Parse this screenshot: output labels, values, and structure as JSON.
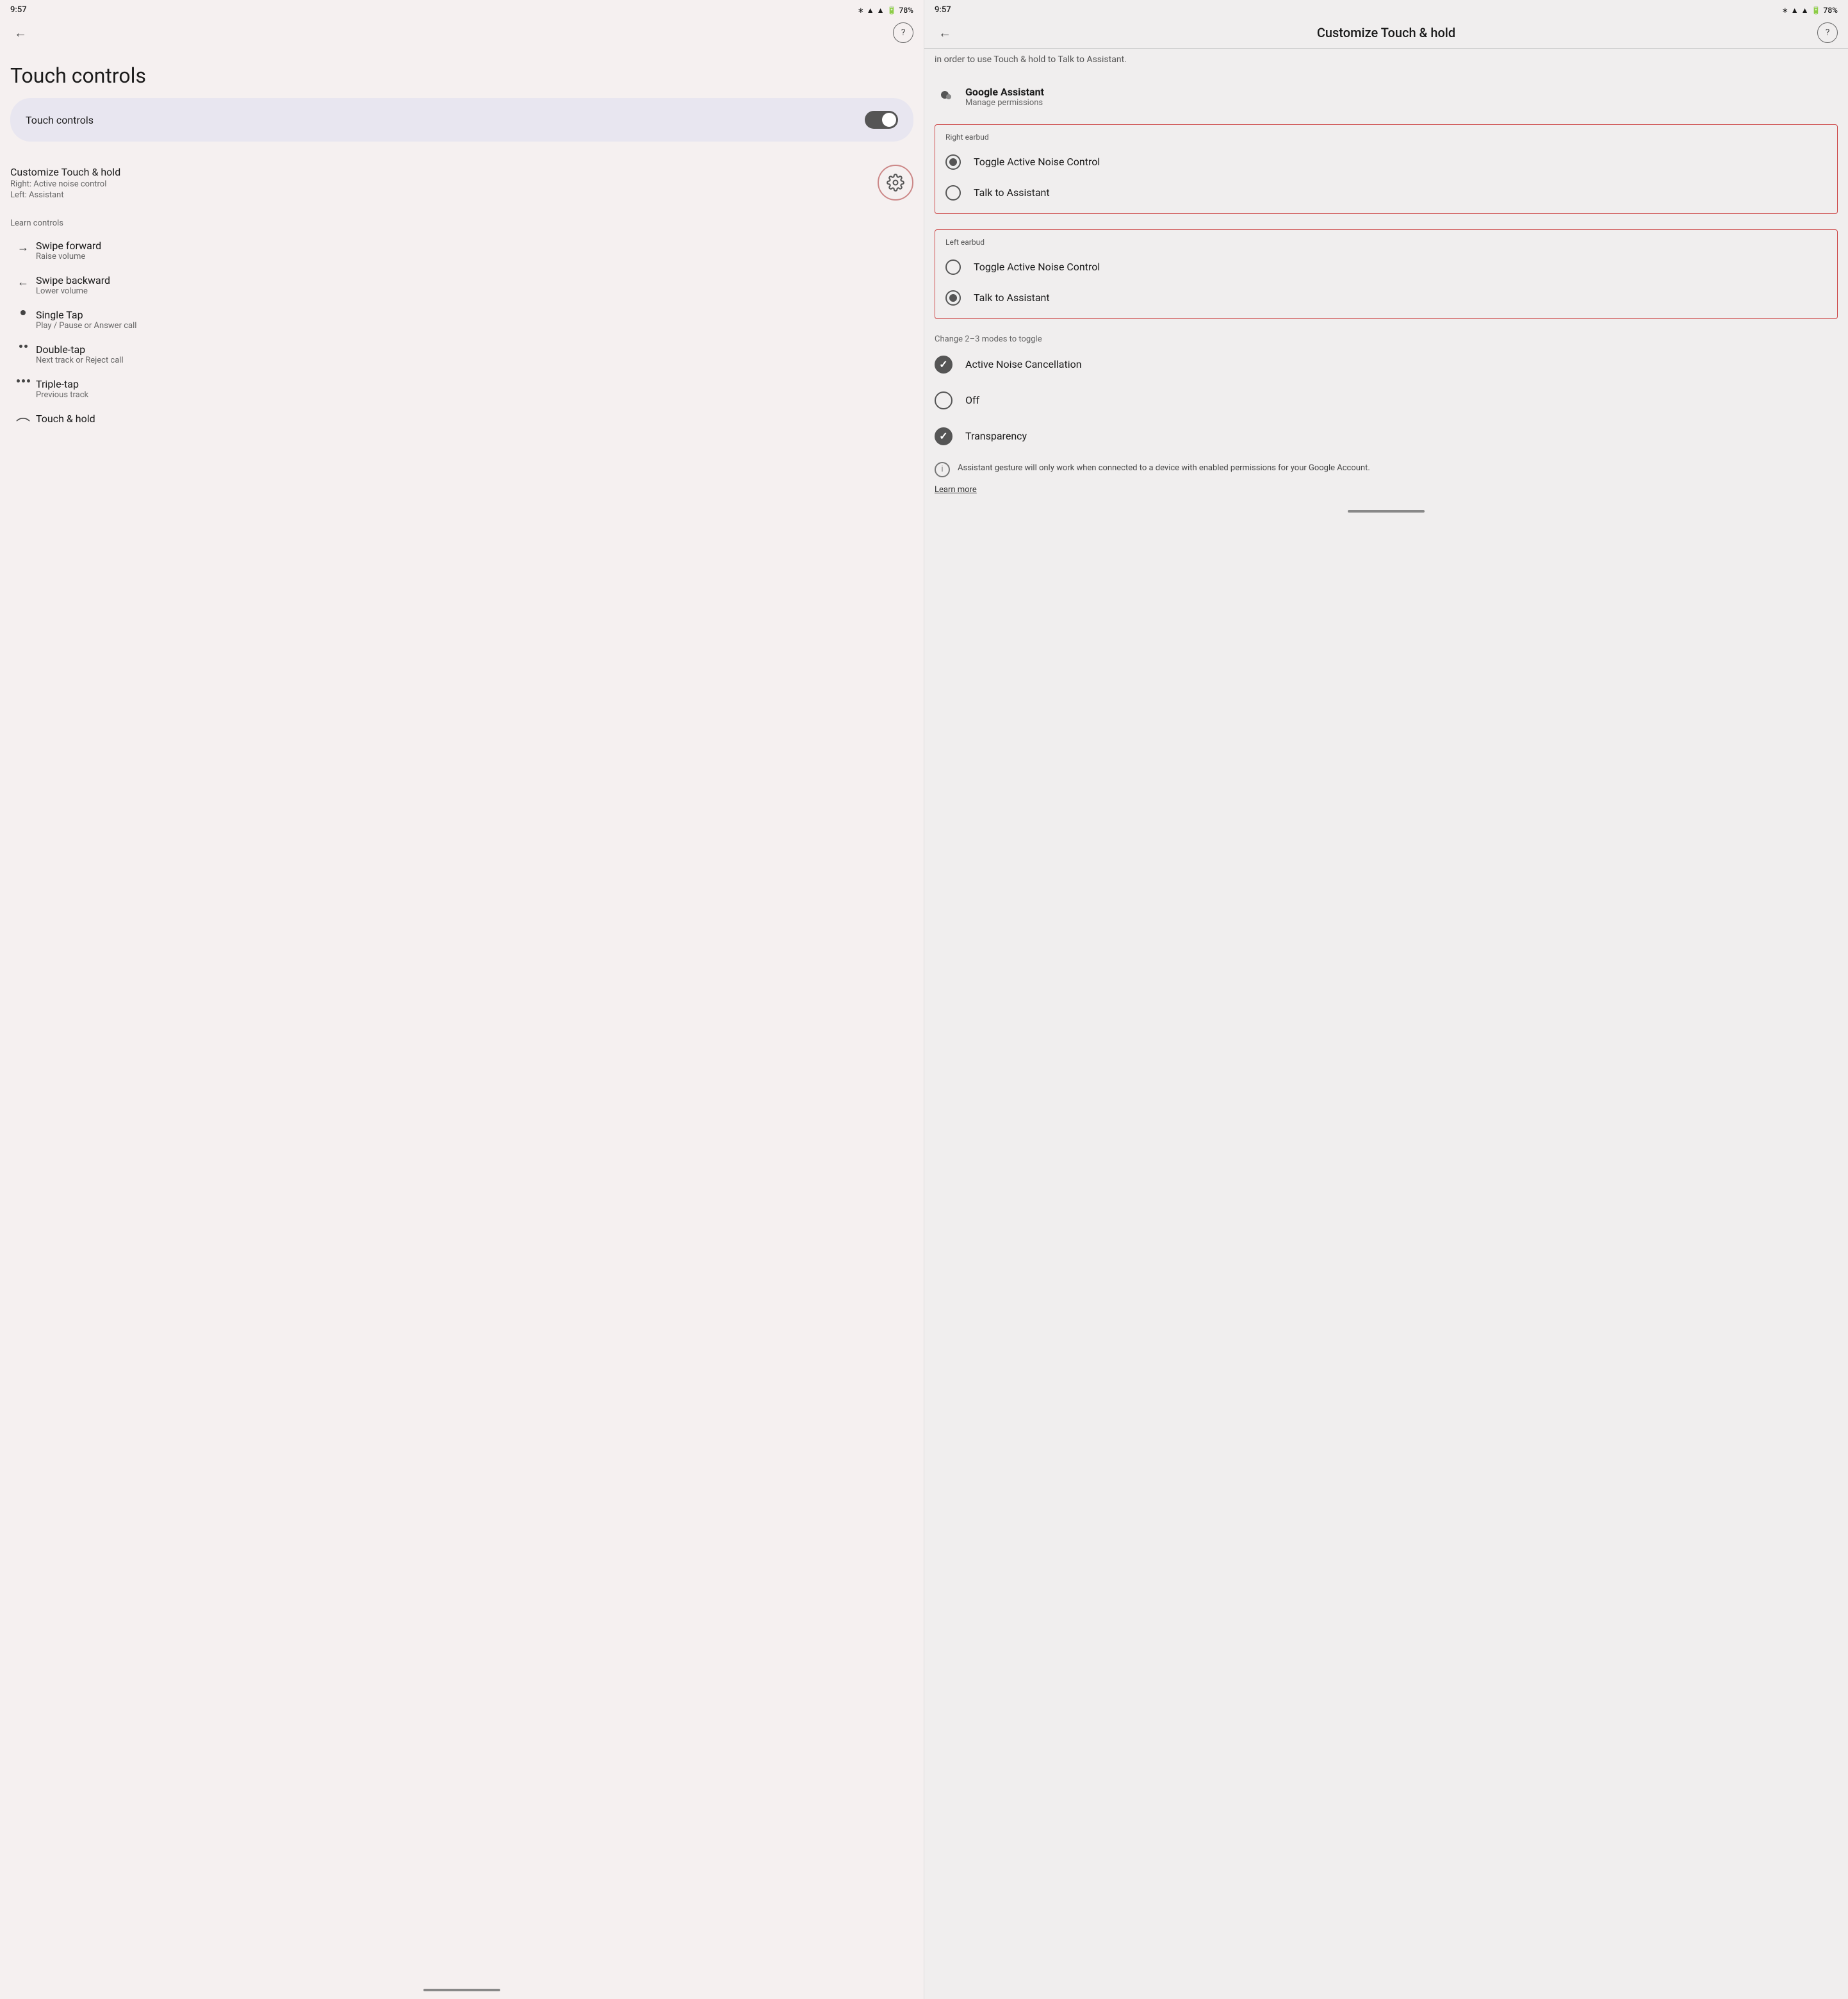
{
  "left_panel": {
    "status_bar": {
      "time": "9:57",
      "battery": "78%"
    },
    "page_title": "Touch controls",
    "toggle_section": {
      "label": "Touch controls",
      "toggle_on": true
    },
    "customize_section": {
      "title": "Customize Touch & hold",
      "subtitle1": "Right: Active noise control",
      "subtitle2": "Left: Assistant"
    },
    "learn_controls_label": "Learn controls",
    "controls": [
      {
        "icon": "→",
        "title": "Swipe forward",
        "description": "Raise volume"
      },
      {
        "icon": "←",
        "title": "Swipe backward",
        "description": "Lower volume"
      },
      {
        "icon": "•",
        "title": "Single Tap",
        "description": "Play / Pause or Answer call"
      },
      {
        "icon": "••",
        "title": "Double-tap",
        "description": "Next track or Reject call"
      },
      {
        "icon": "•••",
        "title": "Triple-tap",
        "description": "Previous track"
      },
      {
        "icon": "⌒",
        "title": "Touch & hold",
        "description": ""
      }
    ]
  },
  "right_panel": {
    "status_bar": {
      "time": "9:57",
      "battery": "78%"
    },
    "top_bar_title": "Customize Touch & hold",
    "subtitle": "in order to use Touch & hold to Talk to Assistant.",
    "google_assistant": {
      "title": "Google Assistant",
      "subtitle": "Manage permissions"
    },
    "right_earbud": {
      "label": "Right earbud",
      "options": [
        {
          "label": "Toggle Active Noise Control",
          "selected": true
        },
        {
          "label": "Talk to Assistant",
          "selected": false
        }
      ]
    },
    "left_earbud": {
      "label": "Left earbud",
      "options": [
        {
          "label": "Toggle Active Noise Control",
          "selected": false
        },
        {
          "label": "Talk to Assistant",
          "selected": true
        }
      ]
    },
    "modes_label": "Change 2–3 modes to toggle",
    "modes": [
      {
        "label": "Active Noise Cancellation",
        "checked": true
      },
      {
        "label": "Off",
        "checked": false
      },
      {
        "label": "Transparency",
        "checked": true
      }
    ],
    "info_text": "Assistant gesture will only work when connected to a device with enabled permissions for your Google Account.",
    "learn_more": "Learn more"
  }
}
